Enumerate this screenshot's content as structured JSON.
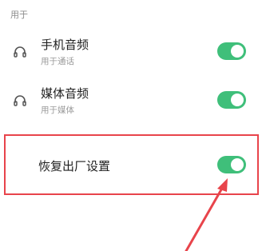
{
  "section": {
    "header": "用于"
  },
  "items": [
    {
      "icon": "headset-icon",
      "title": "手机音频",
      "subtitle": "用于通话",
      "toggle": {
        "on": true
      }
    },
    {
      "icon": "headset-icon",
      "title": "媒体音频",
      "subtitle": "用于媒体",
      "toggle": {
        "on": true
      }
    },
    {
      "title": "恢复出厂设置",
      "toggle": {
        "on": true
      }
    }
  ],
  "colors": {
    "toggle_on": "#3fbf7a",
    "highlight": "#e8444b",
    "title_text": "#1f1f1f",
    "secondary_text": "#9a9a9a"
  }
}
